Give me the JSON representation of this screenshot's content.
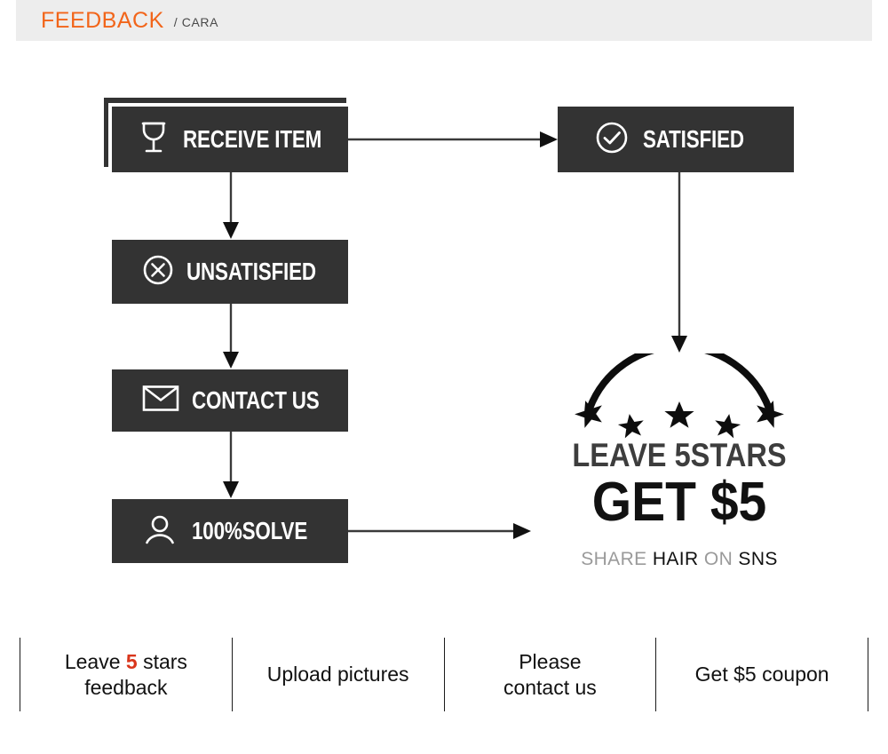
{
  "header": {
    "title": "FEEDBACK",
    "subtitle": "/ CARA",
    "title_color": "#f2651a",
    "bar_color": "#ededed"
  },
  "flow": {
    "box_color": "#333333",
    "text_color": "#ffffff",
    "boxes": [
      {
        "id": "receive-item",
        "label": "RECEIVE ITEM",
        "icon": "wine-glass-icon",
        "stacked": true
      },
      {
        "id": "unsatisfied",
        "label": "UNSATISFIED",
        "icon": "x-circle-icon",
        "stacked": false
      },
      {
        "id": "contact-us",
        "label": "CONTACT US",
        "icon": "envelope-icon",
        "stacked": false
      },
      {
        "id": "solve",
        "label": "100%SOLVE",
        "icon": "user-icon",
        "stacked": false
      },
      {
        "id": "satisfied",
        "label": "SATISFIED",
        "icon": "check-circle-icon",
        "stacked": false
      }
    ],
    "arrows": [
      {
        "id": "receive-to-satisfied",
        "direction": "right"
      },
      {
        "id": "receive-to-unsatisfied",
        "direction": "down"
      },
      {
        "id": "unsatisfied-to-contact",
        "direction": "down"
      },
      {
        "id": "contact-to-solve",
        "direction": "down"
      },
      {
        "id": "satisfied-to-promo",
        "direction": "down"
      },
      {
        "id": "solve-to-promo",
        "direction": "right"
      }
    ]
  },
  "promo": {
    "stars_count": 5,
    "arc": "rating-arc",
    "line1": "LEAVE 5STARS",
    "line2": "GET $5",
    "line3_parts": [
      {
        "text": "SHARE",
        "dim": true
      },
      {
        "text": "HAIR",
        "dim": false
      },
      {
        "text": "ON",
        "dim": true
      },
      {
        "text": "SNS",
        "dim": false
      }
    ],
    "line1_color": "#3d3d3d",
    "line2_color": "#111111",
    "dim_color": "#9a9a9a"
  },
  "footer": {
    "highlight_color": "#d9361c",
    "cells": [
      {
        "id": "leave-stars",
        "pre": "Leave ",
        "hl": "5",
        "post": " stars",
        "second_line": "feedback"
      },
      {
        "id": "upload-pictures",
        "pre": "Upload pictures",
        "hl": "",
        "post": "",
        "second_line": ""
      },
      {
        "id": "please-contact",
        "pre": "Please",
        "hl": "",
        "post": "",
        "second_line": "contact us"
      },
      {
        "id": "get-coupon",
        "pre": "Get $5 coupon",
        "hl": "",
        "post": "",
        "second_line": ""
      }
    ]
  }
}
